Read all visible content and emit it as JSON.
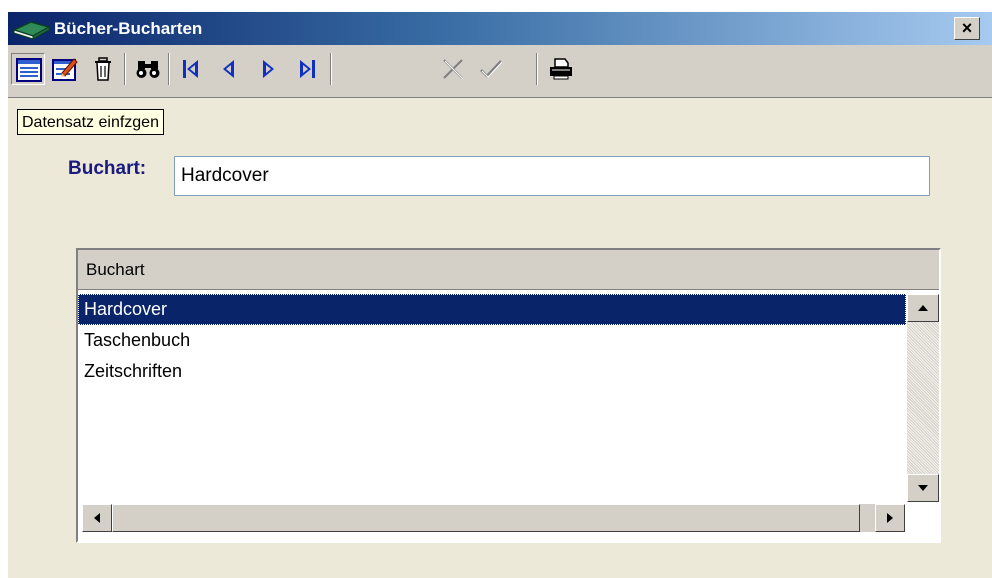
{
  "window": {
    "title": "Bücher-Bucharten",
    "app_icon": "book-icon",
    "close_label": "×"
  },
  "toolbar": {
    "buttons": [
      {
        "name": "new-record",
        "icon": "new-record-icon",
        "pressed": true
      },
      {
        "name": "edit-record",
        "icon": "edit-record-icon"
      },
      {
        "name": "delete-record",
        "icon": "trash-icon"
      },
      {
        "name": "find",
        "icon": "binoculars-icon"
      },
      {
        "name": "first-record",
        "icon": "first-record-icon"
      },
      {
        "name": "previous-record",
        "icon": "previous-record-icon"
      },
      {
        "name": "next-record",
        "icon": "next-record-icon"
      },
      {
        "name": "last-record",
        "icon": "last-record-icon"
      },
      {
        "name": "cancel",
        "icon": "cancel-icon",
        "disabled": true
      },
      {
        "name": "confirm",
        "icon": "checkmark-icon",
        "disabled": true
      },
      {
        "name": "print",
        "icon": "printer-icon"
      }
    ],
    "tooltip": "Datensatz einfzgen"
  },
  "form": {
    "label": "Buchart:",
    "value": "Hardcover"
  },
  "grid": {
    "column_header": "Buchart",
    "rows": [
      "Hardcover",
      "Taschenbuch",
      "Zeitschriften"
    ],
    "selected_index": 0
  },
  "colors": {
    "selection": "#0a246a",
    "label": "#1a1a80",
    "nav_arrows": "#1030c0",
    "face": "#d4d0c8"
  }
}
